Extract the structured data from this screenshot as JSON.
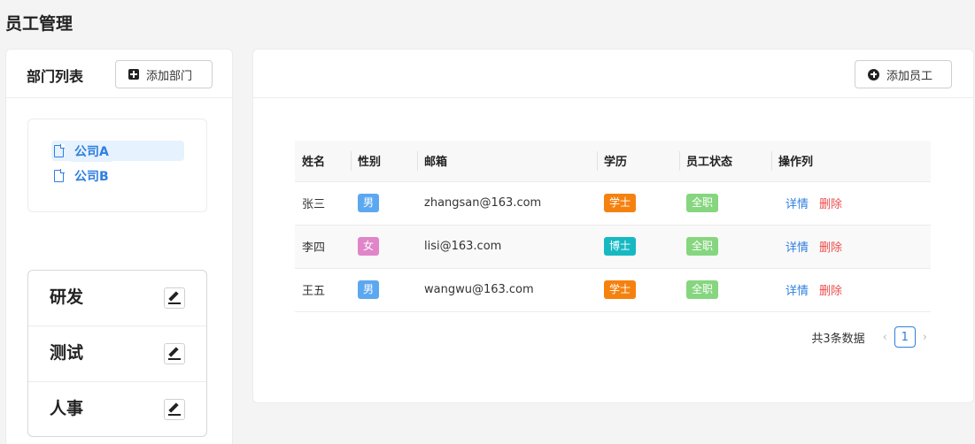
{
  "page_title": "员工管理",
  "left": {
    "title": "部门列表",
    "add_button": "添加部门",
    "tree": [
      {
        "label": "公司A",
        "active": true
      },
      {
        "label": "公司B",
        "active": false
      }
    ],
    "departments": [
      "研发",
      "测试",
      "人事"
    ]
  },
  "right": {
    "add_button": "添加员工",
    "columns": [
      "姓名",
      "性别",
      "邮箱",
      "学历",
      "员工状态",
      "操作列"
    ],
    "rows": [
      {
        "name": "张三",
        "gender": "男",
        "email": "zhangsan@163.com",
        "degree": "学士",
        "status": "全职"
      },
      {
        "name": "李四",
        "gender": "女",
        "email": "lisi@163.com",
        "degree": "博士",
        "status": "全职"
      },
      {
        "name": "王五",
        "gender": "男",
        "email": "wangwu@163.com",
        "degree": "学士",
        "status": "全职"
      }
    ],
    "actions": {
      "detail": "详情",
      "delete": "删除"
    },
    "pagination": {
      "total_text": "共3条数据",
      "current_page": "1",
      "prev": "‹",
      "next": "›"
    }
  },
  "colors": {
    "link": "#2f7fe0",
    "delete": "#ef4d4d",
    "male": "#5ca8f0",
    "female": "#e085c8",
    "bachelor": "#f5820f",
    "doctor": "#16b9c2",
    "status": "#86d67f"
  }
}
